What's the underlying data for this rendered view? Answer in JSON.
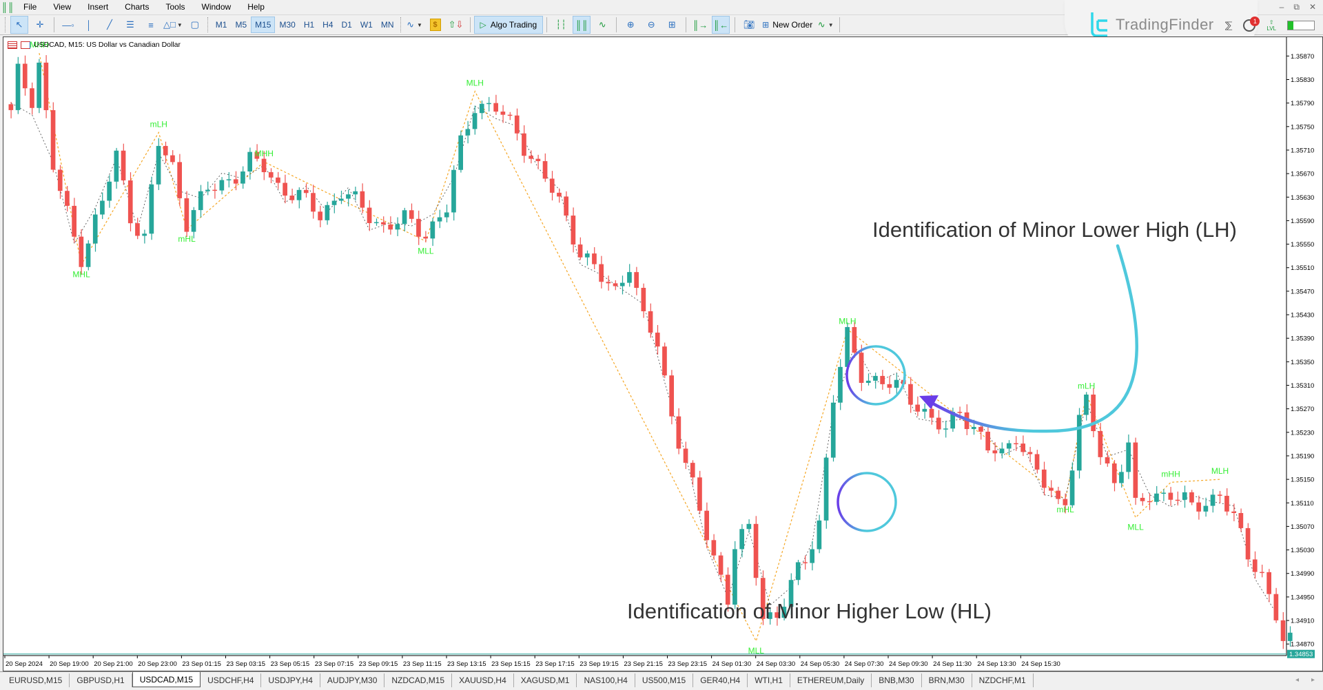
{
  "menubar": {
    "items": [
      "File",
      "View",
      "Insert",
      "Charts",
      "Tools",
      "Window",
      "Help"
    ]
  },
  "toolbar": {
    "timeframes": [
      "M1",
      "M5",
      "M15",
      "M30",
      "H1",
      "H4",
      "D1",
      "W1",
      "MN"
    ],
    "active_timeframe": "M15",
    "algo_trading_label": "Algo Trading",
    "new_order_label": "New Order"
  },
  "branding": {
    "logo_text": "TradingFinder",
    "notification_count": "1",
    "level_label": "LVL",
    "level_progress": 0.2
  },
  "chart": {
    "header": "USDCAD, M15:  US Dollar vs Canadian Dollar",
    "current_price": "1.34853",
    "colors": {
      "bull": "#26a69a",
      "bear": "#ef5350",
      "label": "#33ee33",
      "major_zigzag": "#f5a623",
      "minor_zigzag": "#555555",
      "price_line": "#26a69a",
      "annot_cyan": "#4fc8dc",
      "annot_violet": "#6a3de8"
    },
    "annotations": [
      {
        "text": "Identification of Minor Lower High (LH)"
      },
      {
        "text": "Identification of Minor Higher Low (HL)"
      }
    ]
  },
  "chart_data": {
    "type": "candlestick",
    "symbol": "USDCAD",
    "timeframe": "M15",
    "title": "USDCAD, M15: US Dollar vs Canadian Dollar",
    "y_ticks": [
      "1.35870",
      "1.35830",
      "1.35790",
      "1.35750",
      "1.35710",
      "1.35670",
      "1.35630",
      "1.35590",
      "1.35550",
      "1.35510",
      "1.35470",
      "1.35430",
      "1.35390",
      "1.35350",
      "1.35310",
      "1.35270",
      "1.35230",
      "1.35190",
      "1.35150",
      "1.35110",
      "1.35070",
      "1.35030",
      "1.34990",
      "1.34950",
      "1.34910",
      "1.34870"
    ],
    "ylim": [
      1.34855,
      1.35895
    ],
    "x_ticks": [
      "20 Sep 2024",
      "20 Sep 19:00",
      "20 Sep 21:00",
      "20 Sep 23:00",
      "23 Sep 01:15",
      "23 Sep 03:15",
      "23 Sep 05:15",
      "23 Sep 07:15",
      "23 Sep 09:15",
      "23 Sep 11:15",
      "23 Sep 13:15",
      "23 Sep 15:15",
      "23 Sep 17:15",
      "23 Sep 19:15",
      "23 Sep 21:15",
      "23 Sep 23:15",
      "24 Sep 01:30",
      "24 Sep 03:30",
      "24 Sep 05:30",
      "24 Sep 07:30",
      "24 Sep 09:30",
      "24 Sep 11:30",
      "24 Sep 13:30",
      "24 Sep 15:30"
    ],
    "current_price": 1.34853,
    "structure_labels": [
      {
        "label": "MHH",
        "bar": 4,
        "price": 1.35875,
        "pos": "above"
      },
      {
        "label": "MHL",
        "bar": 10,
        "price": 1.35515,
        "pos": "below"
      },
      {
        "label": "mLH",
        "bar": 21,
        "price": 1.3574,
        "pos": "above"
      },
      {
        "label": "mHL",
        "bar": 25,
        "price": 1.35575,
        "pos": "below"
      },
      {
        "label": "MHH",
        "bar": 36,
        "price": 1.3569,
        "pos": "above"
      },
      {
        "label": "MLL",
        "bar": 59,
        "price": 1.35555,
        "pos": "below"
      },
      {
        "label": "MLH",
        "bar": 66,
        "price": 1.3581,
        "pos": "above"
      },
      {
        "label": "MLL",
        "bar": 106,
        "price": 1.34875,
        "pos": "below"
      },
      {
        "label": "MLH",
        "bar": 119,
        "price": 1.35405,
        "pos": "above"
      },
      {
        "label": "mHL",
        "bar": 150,
        "price": 1.35115,
        "pos": "below"
      },
      {
        "label": "mLH",
        "bar": 153,
        "price": 1.35295,
        "pos": "above"
      },
      {
        "label": "MLL",
        "bar": 160,
        "price": 1.35085,
        "pos": "below"
      },
      {
        "label": "mHH",
        "bar": 165,
        "price": 1.35145,
        "pos": "above"
      },
      {
        "label": "MLH",
        "bar": 172,
        "price": 1.3515,
        "pos": "above"
      }
    ],
    "close_path": [
      [
        0,
        1.3577
      ],
      [
        1,
        1.3584
      ],
      [
        3,
        1.358
      ],
      [
        4,
        1.3586
      ],
      [
        6,
        1.3568
      ],
      [
        9,
        1.3556
      ],
      [
        10,
        1.3553
      ],
      [
        13,
        1.3562
      ],
      [
        15,
        1.357
      ],
      [
        17,
        1.356
      ],
      [
        19,
        1.3556
      ],
      [
        21,
        1.3572
      ],
      [
        23,
        1.3568
      ],
      [
        25,
        1.3559
      ],
      [
        28,
        1.3564
      ],
      [
        31,
        1.3566
      ],
      [
        34,
        1.3569
      ],
      [
        36,
        1.3568
      ],
      [
        38,
        1.3565
      ],
      [
        41,
        1.3563
      ],
      [
        44,
        1.356
      ],
      [
        47,
        1.3564
      ],
      [
        50,
        1.3561
      ],
      [
        53,
        1.3558
      ],
      [
        56,
        1.3559
      ],
      [
        59,
        1.3557
      ],
      [
        62,
        1.3561
      ],
      [
        64,
        1.3572
      ],
      [
        66,
        1.3579
      ],
      [
        69,
        1.3578
      ],
      [
        72,
        1.3574
      ],
      [
        75,
        1.3568
      ],
      [
        78,
        1.3562
      ],
      [
        81,
        1.3554
      ],
      [
        84,
        1.3549
      ],
      [
        86,
        1.3547
      ],
      [
        88,
        1.3552
      ],
      [
        90,
        1.3542
      ],
      [
        92,
        1.3538
      ],
      [
        94,
        1.3526
      ],
      [
        96,
        1.3518
      ],
      [
        98,
        1.3509
      ],
      [
        100,
        1.3502
      ],
      [
        102,
        1.3495
      ],
      [
        103,
        1.3504
      ],
      [
        105,
        1.3506
      ],
      [
        107,
        1.3492
      ],
      [
        109,
        1.3492
      ],
      [
        111,
        1.3497
      ],
      [
        113,
        1.3501
      ],
      [
        115,
        1.3508
      ],
      [
        117,
        1.3529
      ],
      [
        119,
        1.3539
      ],
      [
        121,
        1.3533
      ],
      [
        123,
        1.3532
      ],
      [
        125,
        1.3531
      ],
      [
        127,
        1.353
      ],
      [
        129,
        1.3528
      ],
      [
        131,
        1.3525
      ],
      [
        133,
        1.3523
      ],
      [
        135,
        1.3527
      ],
      [
        137,
        1.3524
      ],
      [
        139,
        1.352
      ],
      [
        141,
        1.3519
      ],
      [
        143,
        1.3523
      ],
      [
        145,
        1.3518
      ],
      [
        147,
        1.3514
      ],
      [
        149,
        1.3511
      ],
      [
        150,
        1.3512
      ],
      [
        151,
        1.3518
      ],
      [
        152,
        1.3525
      ],
      [
        153,
        1.3528
      ],
      [
        155,
        1.3519
      ],
      [
        157,
        1.3515
      ],
      [
        159,
        1.3521
      ],
      [
        160,
        1.351
      ],
      [
        162,
        1.3512
      ],
      [
        165,
        1.3513
      ],
      [
        168,
        1.351
      ],
      [
        170,
        1.3511
      ],
      [
        172,
        1.3513
      ],
      [
        174,
        1.3508
      ],
      [
        176,
        1.3502
      ],
      [
        178,
        1.3499
      ],
      [
        180,
        1.3492
      ],
      [
        181,
        1.3487
      ]
    ]
  },
  "time_axis": {
    "labels": [
      "20 Sep 2024",
      "20 Sep 19:00",
      "20 Sep 21:00",
      "20 Sep 23:00",
      "23 Sep 01:15",
      "23 Sep 03:15",
      "23 Sep 05:15",
      "23 Sep 07:15",
      "23 Sep 09:15",
      "23 Sep 11:15",
      "23 Sep 13:15",
      "23 Sep 15:15",
      "23 Sep 17:15",
      "23 Sep 19:15",
      "23 Sep 21:15",
      "23 Sep 23:15",
      "24 Sep 01:30",
      "24 Sep 03:30",
      "24 Sep 05:30",
      "24 Sep 07:30",
      "24 Sep 09:30",
      "24 Sep 11:30",
      "24 Sep 13:30",
      "24 Sep 15:30"
    ]
  },
  "tabs": {
    "items": [
      "EURUSD,M15",
      "GBPUSD,H1",
      "USDCAD,M15",
      "USDCHF,H4",
      "USDJPY,H4",
      "AUDJPY,M30",
      "NZDCAD,M15",
      "XAUUSD,H4",
      "XAGUSD,M1",
      "NAS100,H4",
      "US500,M15",
      "GER40,H4",
      "WTI,H1",
      "ETHEREUM,Daily",
      "BNB,M30",
      "BRN,M30",
      "NZDCHF,M1"
    ],
    "active": "USDCAD,M15"
  }
}
